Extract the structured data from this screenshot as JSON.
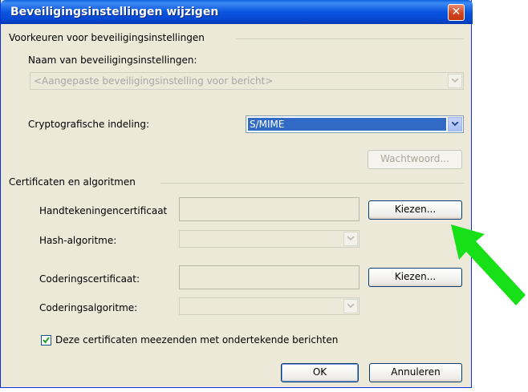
{
  "window": {
    "title": "Beveiligingsinstellingen wijzigen",
    "close_icon": "close-icon"
  },
  "group_prefs": {
    "title": "Voorkeuren voor beveiligingsinstellingen",
    "name_label": "Naam van beveiligingsinstellingen:",
    "name_value": "<Aangepaste beveiligingsinstelling voor bericht>",
    "crypto_label": "Cryptografische indeling:",
    "crypto_value": "S/MIME",
    "password_button": "Wachtwoord..."
  },
  "group_certs": {
    "title": "Certificaten en algoritmen",
    "sign_cert_label": "Handtekeningencertificaat",
    "sign_cert_value": "",
    "choose_button_1": "Kiezen...",
    "hash_label": "Hash-algoritme:",
    "hash_value": "",
    "enc_cert_label": "Coderingscertificaat:",
    "enc_cert_value": "",
    "choose_button_2": "Kiezen...",
    "enc_alg_label": "Coderingsalgoritme:",
    "enc_alg_value": ""
  },
  "send_certs": {
    "label": "Deze certificaten meezenden met ondertekende berichten",
    "checked": true
  },
  "footer": {
    "ok": "OK",
    "cancel": "Annuleren"
  },
  "annotation": {
    "arrow_color": "#18e018",
    "icon": "green-arrow-icon"
  }
}
